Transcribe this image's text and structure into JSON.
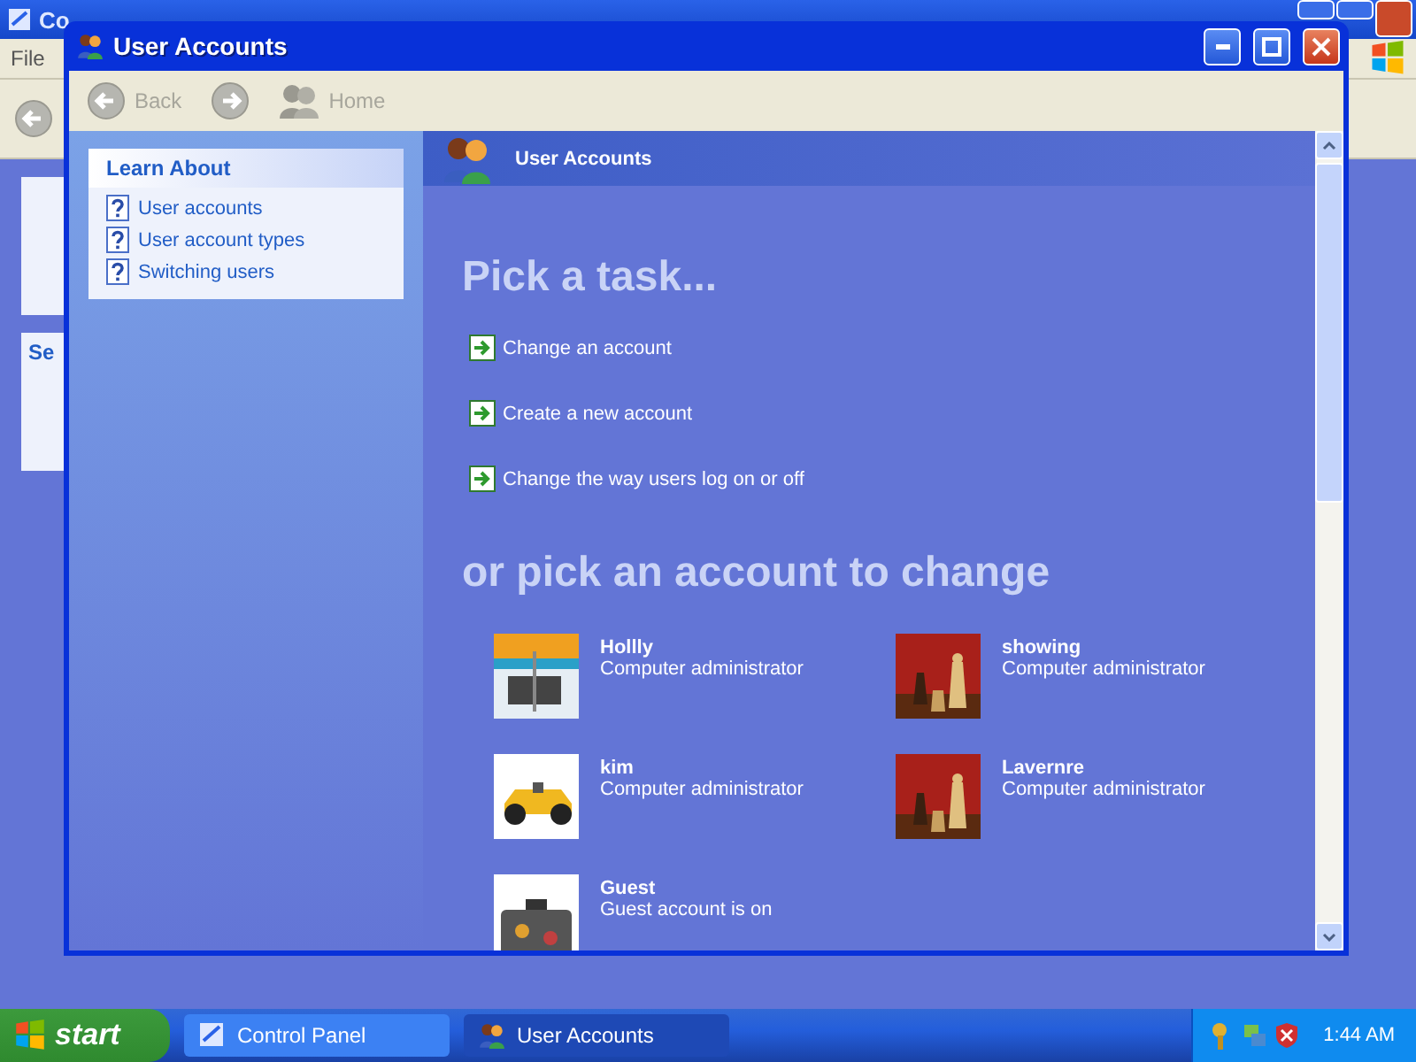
{
  "background_window": {
    "title": "Co",
    "menu": [
      "File"
    ],
    "side_text": "Se"
  },
  "window": {
    "title": "User Accounts"
  },
  "toolbar": [
    {
      "label": "Back",
      "disabled": true,
      "kind": "back"
    },
    {
      "kind": "forward",
      "disabled": true
    },
    {
      "label": "Home",
      "disabled": true,
      "kind": "home"
    }
  ],
  "learn_about": {
    "title": "Learn About",
    "items": [
      "User accounts",
      "User account types",
      "Switching users"
    ]
  },
  "header": "User Accounts",
  "task_heading": "Pick a task...",
  "tasks": [
    "Change an account",
    "Create a new account",
    "Change the way users log on or off"
  ],
  "account_heading": "or pick an account to change",
  "accounts": [
    {
      "name": "Hollly",
      "type": "Computer administrator",
      "kind": "picture"
    },
    {
      "name": "showing",
      "type": "Computer administrator",
      "kind": "picture"
    },
    {
      "name": "kim",
      "type": "Computer administrator",
      "kind": "picture"
    },
    {
      "name": "Lavernre",
      "type": "Computer administrator",
      "kind": "picture"
    },
    {
      "name": "Guest",
      "type": "Guest account is on",
      "kind": "picture"
    }
  ],
  "taskbar": {
    "start": "start",
    "buttons": [
      {
        "label": "Control Panel",
        "selected": false
      },
      {
        "label": "User Accounts",
        "selected": true
      }
    ],
    "clock": "1:44 AM"
  }
}
